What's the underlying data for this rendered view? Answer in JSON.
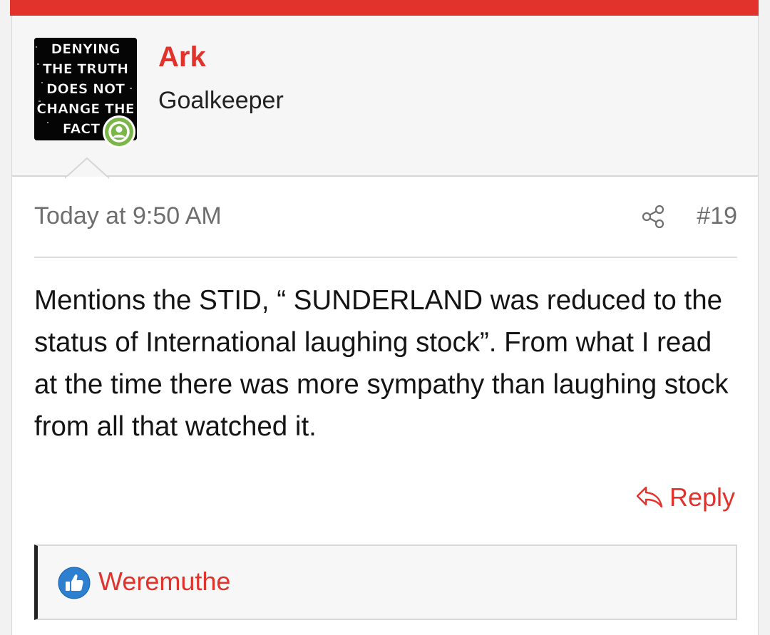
{
  "theme": {
    "accent": "#e1322b",
    "online": "#7ab648",
    "like": "#2d7fd0"
  },
  "user": {
    "name": "Ark",
    "title": "Goalkeeper",
    "avatar_text": [
      "DENYING",
      "THE TRUTH",
      "DOES NOT",
      "CHANGE THE",
      "FACT"
    ],
    "online": true
  },
  "post": {
    "timestamp": "Today at 9:50 AM",
    "number": "#19",
    "message": "Mentions the STID, “ SUNDERLAND was reduced to the status of International laughing stock”. From what I read at the time there was more sympathy than laughing stock from all that watched it.",
    "reply_label": "Reply"
  },
  "reactions": {
    "users": [
      "Weremuthe"
    ]
  },
  "icons": {
    "share": "share-icon",
    "reply": "reply-arrow-icon",
    "like": "thumbs-up-icon",
    "online": "user-online-icon"
  }
}
